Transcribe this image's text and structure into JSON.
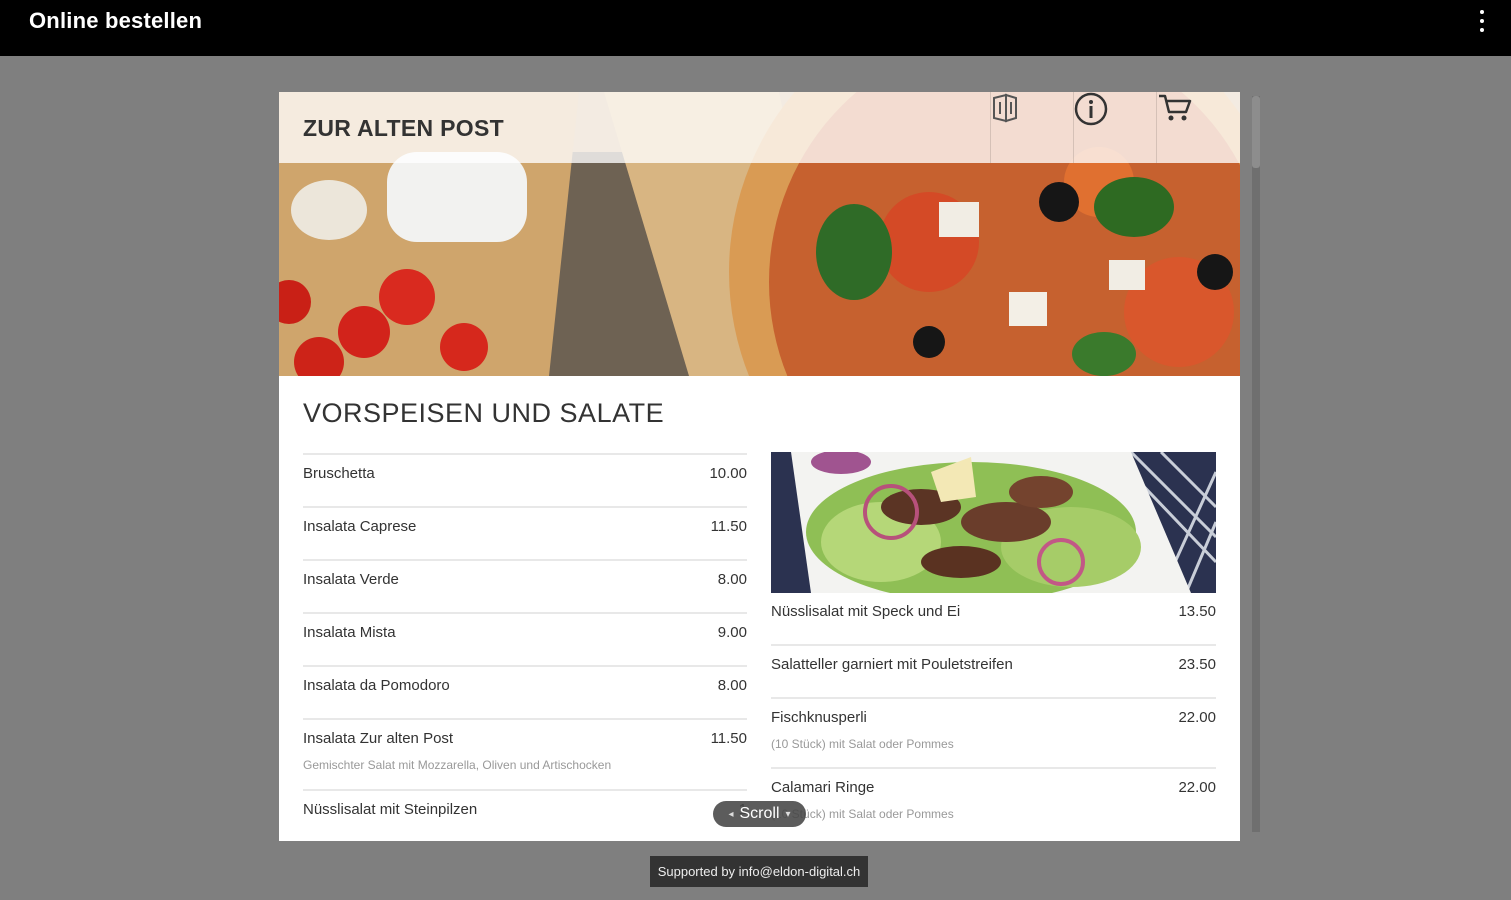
{
  "app": {
    "title": "Online bestellen",
    "menu_icon": "more-vert-icon"
  },
  "restaurant": {
    "name": "ZUR ALTEN POST"
  },
  "header_buttons": [
    {
      "icon": "menu-book-icon"
    },
    {
      "icon": "info-icon"
    },
    {
      "icon": "cart-icon"
    }
  ],
  "section": {
    "title": "VORSPEISEN UND SALATE"
  },
  "items_left": [
    {
      "name": "Bruschetta",
      "price": "10.00",
      "desc": ""
    },
    {
      "name": "Insalata Caprese",
      "price": "11.50",
      "desc": ""
    },
    {
      "name": "Insalata Verde",
      "price": "8.00",
      "desc": ""
    },
    {
      "name": "Insalata Mista",
      "price": "9.00",
      "desc": ""
    },
    {
      "name": "Insalata da Pomodoro",
      "price": "8.00",
      "desc": ""
    },
    {
      "name": "Insalata Zur alten Post",
      "price": "11.50",
      "desc": "Gemischter Salat mit Mozzarella, Oliven und Artischocken"
    },
    {
      "name": "Nüsslisalat mit Steinpilzen",
      "price": "1",
      "desc": ""
    }
  ],
  "items_right": [
    {
      "name": "Nüsslisalat mit Speck und Ei",
      "price": "13.50",
      "desc": ""
    },
    {
      "name": "Salatteller garniert mit Pouletstreifen",
      "price": "23.50",
      "desc": ""
    },
    {
      "name": "Fischknusperli",
      "price": "22.00",
      "desc": "(10 Stück) mit Salat oder Pommes"
    },
    {
      "name": "Calamari Ringe",
      "price": "22.00",
      "desc": "(10 Stück) mit Salat oder Pommes"
    }
  ],
  "scroll_pill": {
    "label": "Scroll"
  },
  "footer": {
    "support": "Supported by info@eldon-digital.ch"
  }
}
